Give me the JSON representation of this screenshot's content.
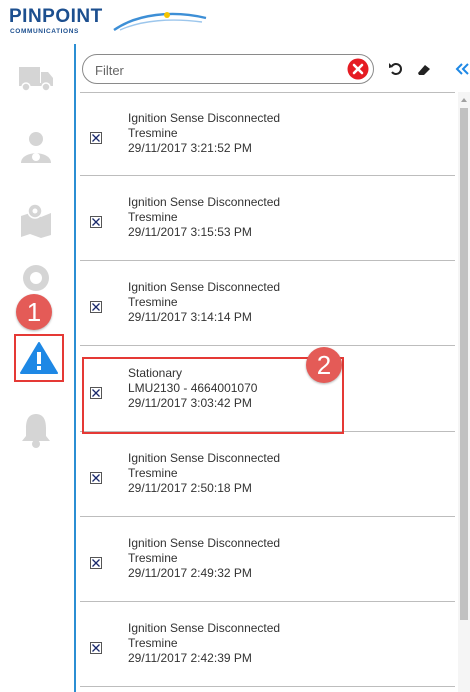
{
  "brand": {
    "name": "PINPOINT",
    "sub": "COMMUNICATIONS"
  },
  "filter": {
    "placeholder": "Filter",
    "value": ""
  },
  "toolbar": {
    "clear_icon": "close-circle-icon",
    "refresh_icon": "refresh-icon",
    "eraser_icon": "eraser-icon",
    "collapse_icon": "double-chevron-left-icon"
  },
  "sidebar": {
    "items": [
      {
        "name": "truck-icon"
      },
      {
        "name": "driver-icon"
      },
      {
        "name": "map-icon"
      },
      {
        "name": "location-pin-icon"
      },
      {
        "name": "alert-warning-icon",
        "active": true
      },
      {
        "name": "bell-icon"
      }
    ]
  },
  "annotations": {
    "step1": "1",
    "step2": "2"
  },
  "alerts": [
    {
      "title": "Ignition Sense Disconnected",
      "device": "Tresmine",
      "time": "29/11/2017 3:21:52 PM"
    },
    {
      "title": "Ignition Sense Disconnected",
      "device": "Tresmine",
      "time": "29/11/2017 3:15:53 PM"
    },
    {
      "title": "Ignition Sense Disconnected",
      "device": "Tresmine",
      "time": "29/11/2017 3:14:14 PM"
    },
    {
      "title": "Stationary",
      "device": "LMU2130 - 4664001070",
      "time": "29/11/2017 3:03:42 PM"
    },
    {
      "title": "Ignition Sense Disconnected",
      "device": "Tresmine",
      "time": "29/11/2017 2:50:18 PM"
    },
    {
      "title": "Ignition Sense Disconnected",
      "device": "Tresmine",
      "time": "29/11/2017 2:49:32 PM"
    },
    {
      "title": "Ignition Sense Disconnected",
      "device": "Tresmine",
      "time": "29/11/2017 2:42:39 PM"
    }
  ],
  "colors": {
    "accent": "#2b8ed3",
    "highlight": "#e53935",
    "badge": "#e45b57"
  }
}
